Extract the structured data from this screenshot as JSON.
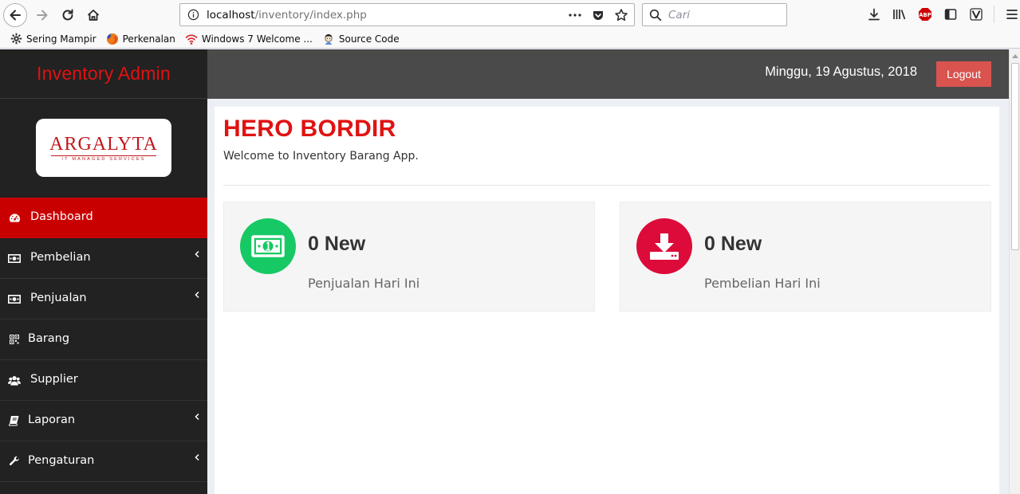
{
  "browser": {
    "url_host": "localhost",
    "url_path": "/inventory/index.php",
    "search_placeholder": "Cari",
    "url_actions": [
      "more-icon",
      "pocket-icon",
      "bookmark-star-icon"
    ],
    "toolbar_icons": [
      "download-icon",
      "library-icon",
      "adblock-icon",
      "sidebar-icon",
      "vimium-icon",
      "hamburger-menu-icon"
    ],
    "adblock_label": "ABP",
    "bookmarks": [
      {
        "label": "Sering Mampir",
        "icon": "gear-icon"
      },
      {
        "label": "Perkenalan",
        "icon": "firefox-icon"
      },
      {
        "label": "Windows 7 Welcome ...",
        "icon": "wifi-icon"
      },
      {
        "label": "Source Code",
        "icon": "person-icon"
      }
    ]
  },
  "app": {
    "brand": "Inventory Admin",
    "logo": {
      "main": "ARGALYTA",
      "sub": "IT MANAGED SERVICES"
    },
    "date": "Minggu, 19 Agustus, 2018",
    "logout_label": "Logout",
    "menu": [
      {
        "label": "Dashboard",
        "icon": "dashboard-icon",
        "active": true,
        "has_submenu": false
      },
      {
        "label": "Pembelian",
        "icon": "money-icon",
        "active": false,
        "has_submenu": true
      },
      {
        "label": "Penjualan",
        "icon": "money-icon",
        "active": false,
        "has_submenu": true
      },
      {
        "label": "Barang",
        "icon": "qrcode-icon",
        "active": false,
        "has_submenu": false
      },
      {
        "label": "Supplier",
        "icon": "users-icon",
        "active": false,
        "has_submenu": false
      },
      {
        "label": "Laporan",
        "icon": "book-icon",
        "active": false,
        "has_submenu": true
      },
      {
        "label": "Pengaturan",
        "icon": "wrench-icon",
        "active": false,
        "has_submenu": true
      }
    ],
    "page_title": "HERO BORDIR",
    "welcome": "Welcome to Inventory Barang App.",
    "stats": [
      {
        "value": "0 New",
        "label": "Penjualan Hari Ini",
        "icon": "money-bill-icon",
        "color": "#17c964"
      },
      {
        "value": "0 New",
        "label": "Pembelian Hari Ini",
        "icon": "download-icon",
        "color": "#dc0b3a"
      }
    ]
  },
  "colors": {
    "brand_red": "#e01212",
    "sidebar_bg": "#222222",
    "active_menu": "#c90000",
    "topbar_bg": "#4a4a4a",
    "logout_btn": "#d9534f"
  }
}
